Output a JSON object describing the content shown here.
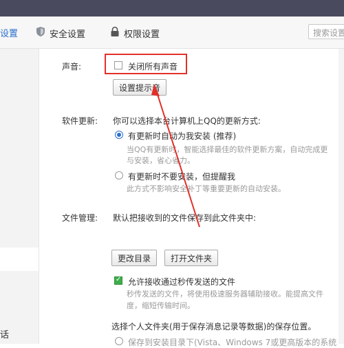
{
  "tabs": {
    "general": "设置",
    "security": "安全设置",
    "permission": "权限设置"
  },
  "search": {
    "placeholder": "搜索设置"
  },
  "sidebar": {
    "bottom_label": "话"
  },
  "sound": {
    "label": "声音:",
    "mute_all": "关闭所有声音",
    "mute_checked": false,
    "button": "设置提示音"
  },
  "update": {
    "label": "软件更新:",
    "intro": "你可以选择本台计算机上QQ的更新方式:",
    "option_auto": "有更新时自动为我安装 (推荐)",
    "option_auto_desc1": "当QQ有更新时，智能选择最佳的软件更新方案，自动完成更",
    "option_auto_desc2": "与安装，省心省力。",
    "option_notify": "有更新时不要安装，但提醒我",
    "option_notify_desc": "此方式不影响安全补丁等重要更新的自动安装。",
    "selected": "auto"
  },
  "files": {
    "label": "文件管理:",
    "intro": "默认把接收到的文件保存到此文件夹中:",
    "change_btn": "更改目录",
    "open_btn": "打开文件夹",
    "fast_transfer": "允许接收通过秒传发送的文件",
    "fast_checked": true,
    "fast_desc1": "秒传发送的文件，将使用极速服务器辅助接收。能提高文件",
    "fast_desc2": "度，缩短传输时间。",
    "personal_folder": "选择个人文件夹(用于保存消息记录等数据)的保存位置。",
    "personal_option": "保存到安装目录下(Vista、Windows 7或更高版本的系统"
  },
  "colors": {
    "accent": "#2a6fc9",
    "annotation": "#e0302a",
    "check_green": "#3fae4a"
  }
}
